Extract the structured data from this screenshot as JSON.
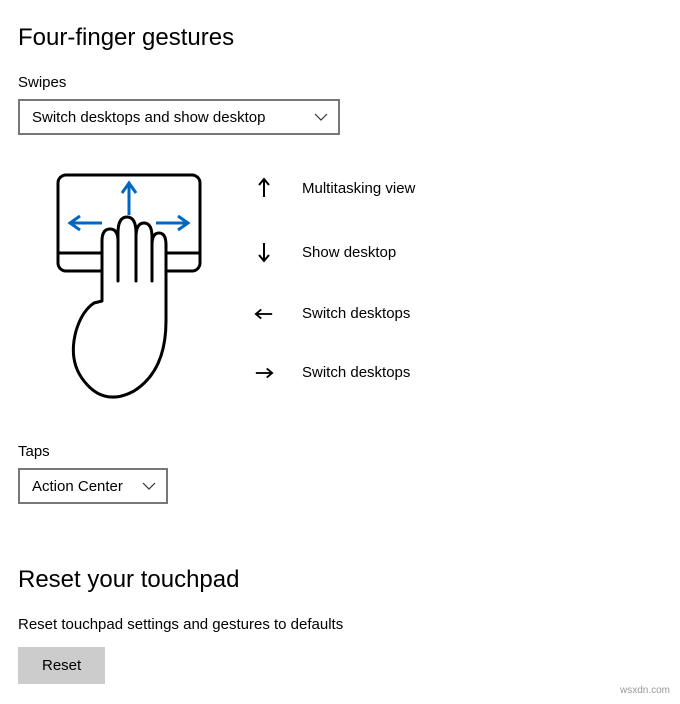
{
  "sectionTitle": "Four-finger gestures",
  "swipes": {
    "label": "Swipes",
    "selected": "Switch desktops and show desktop"
  },
  "gestures": {
    "up": "Multitasking view",
    "down": "Show desktop",
    "left": "Switch desktops",
    "right": "Switch desktops"
  },
  "taps": {
    "label": "Taps",
    "selected": "Action Center"
  },
  "reset": {
    "title": "Reset your touchpad",
    "description": "Reset touchpad settings and gestures to defaults",
    "buttonLabel": "Reset"
  },
  "watermark": "wsxdn.com"
}
